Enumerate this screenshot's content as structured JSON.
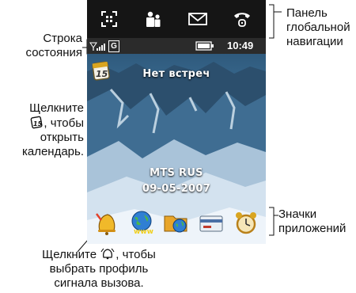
{
  "callouts": {
    "global_nav": [
      "Панель",
      "глобальной",
      "навигации"
    ],
    "status_row": [
      "Строка",
      "состояния"
    ],
    "calendar": [
      "Щелкните",
      ", чтобы",
      "открыть",
      "календарь."
    ],
    "app_icons": [
      "Значки",
      "приложений"
    ],
    "ring_profile_lead": "Щелкните ",
    "ring_profile": [
      ", чтобы",
      "выбрать профиль",
      "сигнала вызова."
    ]
  },
  "phone": {
    "nav_icons": [
      "dialpad-grid-icon",
      "contacts-icon",
      "envelope-icon",
      "phone-handset-icon"
    ],
    "status": {
      "network": "G",
      "time": "10:49"
    },
    "calendar_date": "15",
    "no_meetings": "Нет встреч",
    "operator": "MTS RUS",
    "date": "09-05-2007",
    "app_icons": [
      "bell-icon",
      "globe-www-icon",
      "folder-globe-icon",
      "card-icon",
      "alarm-clock-icon"
    ],
    "app_icon_labels": {
      "browser": "www"
    }
  },
  "colors": {
    "nav_bg": "#151515",
    "status_bg": "#2b2b2b",
    "wallpaper_sky": "#2f5a7d",
    "text": "#111111"
  }
}
